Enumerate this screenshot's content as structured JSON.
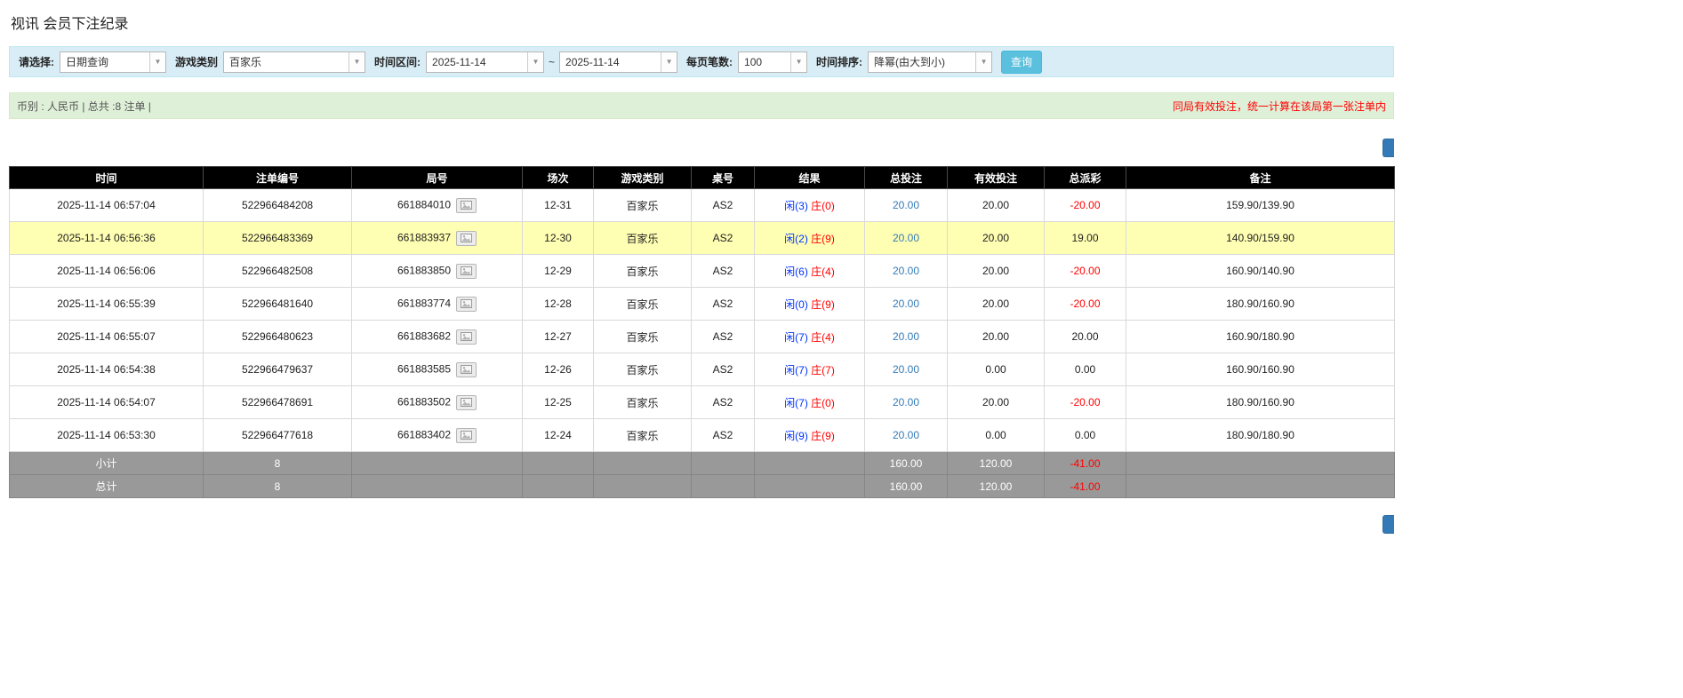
{
  "page": {
    "title": "视讯 会员下注纪录"
  },
  "icons": {
    "dropdown_arrow": "▼"
  },
  "filter": {
    "select_label": "请选择:",
    "select_value": "日期查询",
    "game_type_label": "游戏类别",
    "game_type_value": "百家乐",
    "date_range_label": "时间区间:",
    "date_from": "2025-11-14",
    "date_separator": "~",
    "date_to": "2025-11-14",
    "page_size_label": "每页笔数:",
    "page_size_value": "100",
    "sort_label": "时间排序:",
    "sort_value": "降幂(由大到小)",
    "search_button": "查询"
  },
  "info_bar": {
    "summary": "币别 : 人民币 | 总共 :8 注单 |",
    "notice": "同局有效投注，统一计算在该局第一张注单内"
  },
  "table": {
    "headers": [
      "时间",
      "注单编号",
      "局号",
      "场次",
      "游戏类别",
      "桌号",
      "结果",
      "总投注",
      "有效投注",
      "总派彩",
      "备注"
    ],
    "rows": [
      {
        "time": "2025-11-14 06:57:04",
        "bet_id": "522966484208",
        "round_id": "661884010",
        "session": "12-31",
        "game": "百家乐",
        "table_no": "AS2",
        "result_player": "闲(3)",
        "result_banker": "庄(0)",
        "total_bet": "20.00",
        "valid_bet": "20.00",
        "payout": "-20.00",
        "remark": "159.90/139.90",
        "highlighted": false
      },
      {
        "time": "2025-11-14 06:56:36",
        "bet_id": "522966483369",
        "round_id": "661883937",
        "session": "12-30",
        "game": "百家乐",
        "table_no": "AS2",
        "result_player": "闲(2)",
        "result_banker": "庄(9)",
        "total_bet": "20.00",
        "valid_bet": "20.00",
        "payout": "19.00",
        "remark": "140.90/159.90",
        "highlighted": true
      },
      {
        "time": "2025-11-14 06:56:06",
        "bet_id": "522966482508",
        "round_id": "661883850",
        "session": "12-29",
        "game": "百家乐",
        "table_no": "AS2",
        "result_player": "闲(6)",
        "result_banker": "庄(4)",
        "total_bet": "20.00",
        "valid_bet": "20.00",
        "payout": "-20.00",
        "remark": "160.90/140.90",
        "highlighted": false
      },
      {
        "time": "2025-11-14 06:55:39",
        "bet_id": "522966481640",
        "round_id": "661883774",
        "session": "12-28",
        "game": "百家乐",
        "table_no": "AS2",
        "result_player": "闲(0)",
        "result_banker": "庄(9)",
        "total_bet": "20.00",
        "valid_bet": "20.00",
        "payout": "-20.00",
        "remark": "180.90/160.90",
        "highlighted": false
      },
      {
        "time": "2025-11-14 06:55:07",
        "bet_id": "522966480623",
        "round_id": "661883682",
        "session": "12-27",
        "game": "百家乐",
        "table_no": "AS2",
        "result_player": "闲(7)",
        "result_banker": "庄(4)",
        "total_bet": "20.00",
        "valid_bet": "20.00",
        "payout": "20.00",
        "remark": "160.90/180.90",
        "highlighted": false
      },
      {
        "time": "2025-11-14 06:54:38",
        "bet_id": "522966479637",
        "round_id": "661883585",
        "session": "12-26",
        "game": "百家乐",
        "table_no": "AS2",
        "result_player": "闲(7)",
        "result_banker": "庄(7)",
        "total_bet": "20.00",
        "valid_bet": "0.00",
        "payout": "0.00",
        "remark": "160.90/160.90",
        "highlighted": false
      },
      {
        "time": "2025-11-14 06:54:07",
        "bet_id": "522966478691",
        "round_id": "661883502",
        "session": "12-25",
        "game": "百家乐",
        "table_no": "AS2",
        "result_player": "闲(7)",
        "result_banker": "庄(0)",
        "total_bet": "20.00",
        "valid_bet": "20.00",
        "payout": "-20.00",
        "remark": "180.90/160.90",
        "highlighted": false
      },
      {
        "time": "2025-11-14 06:53:30",
        "bet_id": "522966477618",
        "round_id": "661883402",
        "session": "12-24",
        "game": "百家乐",
        "table_no": "AS2",
        "result_player": "闲(9)",
        "result_banker": "庄(9)",
        "total_bet": "20.00",
        "valid_bet": "0.00",
        "payout": "0.00",
        "remark": "180.90/180.90",
        "highlighted": false
      }
    ],
    "subtotal": {
      "label": "小计",
      "count": "8",
      "total_bet": "160.00",
      "valid_bet": "120.00",
      "payout": "-41.00",
      "remark": ""
    },
    "total": {
      "label": "总计",
      "count": "8",
      "total_bet": "160.00",
      "valid_bet": "120.00",
      "payout": "-41.00",
      "remark": ""
    }
  },
  "colors": {
    "accent_blue": "#5bc0de",
    "link_blue": "#337ab7",
    "player_blue": "#0033ff",
    "banker_red": "#ff0000",
    "negative_red": "#ff0000",
    "highlight_yellow": "#ffffb3",
    "header_black": "#000000",
    "footer_gray": "#999999",
    "filter_bar_bg": "#d9edf7",
    "info_bar_bg": "#dff0d8"
  }
}
